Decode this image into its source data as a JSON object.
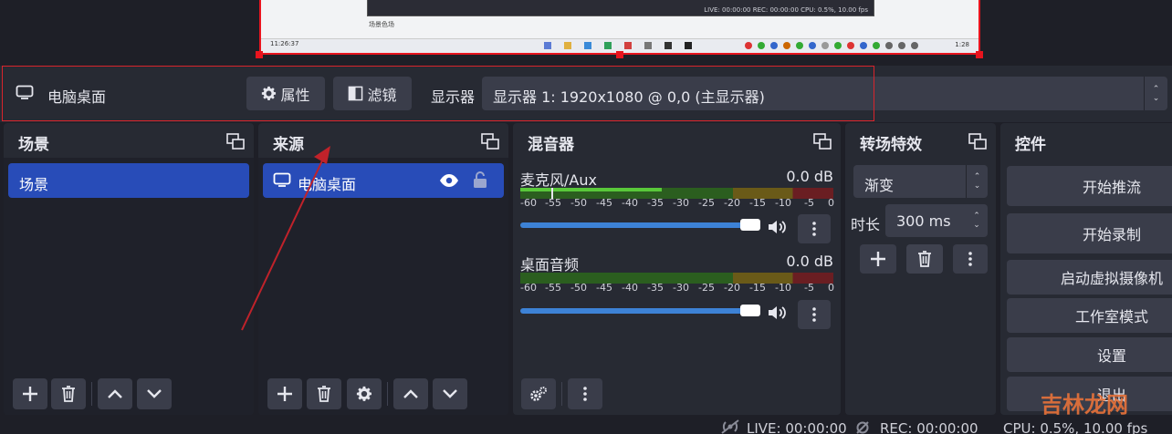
{
  "preview": {
    "obs_status": "LIVE: 00:00:00   REC: 00:00:00   CPU: 0.5%, 10.00 fps",
    "clock_left": "11:26:37",
    "scene_label": "场景色场",
    "taskbar_time": "1:28"
  },
  "source_toolbar": {
    "source_name": "电脑桌面",
    "properties_label": "属性",
    "filters_label": "滤镜",
    "display_label": "显示器",
    "display_value": "显示器 1: 1920x1080 @ 0,0 (主显示器)"
  },
  "scenes": {
    "title": "场景",
    "items": [
      {
        "label": "场景"
      }
    ]
  },
  "sources": {
    "title": "来源",
    "items": [
      {
        "label": "电脑桌面"
      }
    ]
  },
  "mixer": {
    "title": "混音器",
    "channels": [
      {
        "name": "麦克风/Aux",
        "db": "0.0 dB",
        "volume": 1.0
      },
      {
        "name": "桌面音频",
        "db": "0.0 dB",
        "volume": 1.0
      }
    ],
    "scale_ticks": [
      "-60",
      "-55",
      "-50",
      "-45",
      "-40",
      "-35",
      "-30",
      "-25",
      "-20",
      "-15",
      "-10",
      "-5",
      "0"
    ]
  },
  "transitions": {
    "title": "转场特效",
    "type_value": "渐变",
    "duration_label": "时长",
    "duration_value": "300 ms"
  },
  "controls": {
    "title": "控件",
    "buttons": [
      "开始推流",
      "开始录制",
      "启动虚拟摄像机",
      "工作室模式",
      "设置",
      "退出"
    ]
  },
  "statusbar": {
    "live": "LIVE: 00:00:00",
    "rec": "REC: 00:00:00",
    "cpu": "CPU: 0.5%, 10.00 fps"
  },
  "watermark": "吉林龙网",
  "colors": {
    "accent_blue": "#284cb8",
    "highlight_red": "#e8141e",
    "slider_blue": "#3d82d6"
  }
}
